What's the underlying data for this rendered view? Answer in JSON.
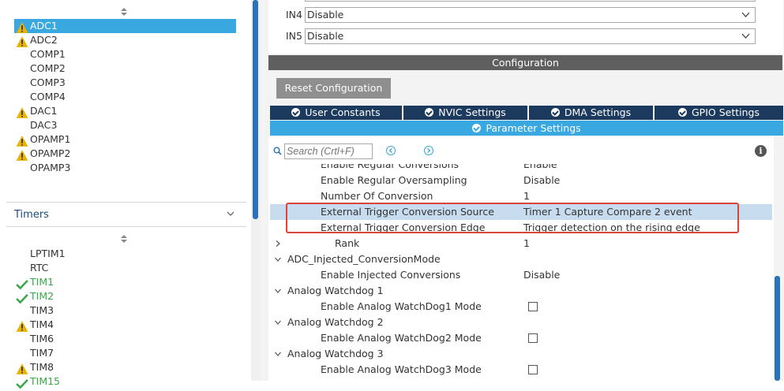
{
  "left_panel": {
    "analog_items": [
      {
        "label": "ADC1",
        "status": "warning",
        "selected": true
      },
      {
        "label": "ADC2",
        "status": "warning",
        "selected": false
      },
      {
        "label": "COMP1",
        "status": "none",
        "selected": false
      },
      {
        "label": "COMP2",
        "status": "none",
        "selected": false
      },
      {
        "label": "COMP3",
        "status": "none",
        "selected": false
      },
      {
        "label": "COMP4",
        "status": "none",
        "selected": false
      },
      {
        "label": "DAC1",
        "status": "warning",
        "selected": false
      },
      {
        "label": "DAC3",
        "status": "none",
        "selected": false
      },
      {
        "label": "OPAMP1",
        "status": "warning",
        "selected": false
      },
      {
        "label": "OPAMP2",
        "status": "warning",
        "selected": false
      },
      {
        "label": "OPAMP3",
        "status": "none",
        "selected": false
      }
    ],
    "timers_title": "Timers",
    "timer_items": [
      {
        "label": "LPTIM1",
        "status": "none"
      },
      {
        "label": "RTC",
        "status": "none"
      },
      {
        "label": "TIM1",
        "status": "ok"
      },
      {
        "label": "TIM2",
        "status": "ok"
      },
      {
        "label": "TIM3",
        "status": "none"
      },
      {
        "label": "TIM4",
        "status": "warning"
      },
      {
        "label": "TIM6",
        "status": "none"
      },
      {
        "label": "TIM7",
        "status": "none"
      },
      {
        "label": "TIM8",
        "status": "warning"
      },
      {
        "label": "TIM15",
        "status": "ok"
      }
    ]
  },
  "inputs": {
    "in4": {
      "label": "IN4",
      "value": "Disable"
    },
    "in5": {
      "label": "IN5",
      "value": "Disable"
    }
  },
  "configuration": {
    "header": "Configuration",
    "reset_button": "Reset Configuration",
    "tabs": [
      "User Constants",
      "NVIC Settings",
      "DMA Settings",
      "GPIO Settings"
    ],
    "active_tab": "Parameter Settings",
    "search_placeholder": "Search (Crtl+F)"
  },
  "parameters": [
    {
      "label": "Enable Regular Conversions",
      "value": "Enable",
      "indent": 2,
      "kind": "value"
    },
    {
      "label": "Enable Regular Oversampling",
      "value": "Disable",
      "indent": 2,
      "kind": "value"
    },
    {
      "label": "Number Of Conversion",
      "value": "1",
      "indent": 2,
      "kind": "value"
    },
    {
      "label": "External Trigger Conversion Source",
      "value": "Timer 1 Capture Compare 2 event",
      "indent": 2,
      "kind": "value",
      "highlight": true
    },
    {
      "label": "External Trigger Conversion Edge",
      "value": "Trigger detection on the rising edge",
      "indent": 2,
      "kind": "value"
    },
    {
      "label": "Rank",
      "value": "1",
      "indent": 3,
      "kind": "collapsed"
    },
    {
      "label": "ADC_Injected_ConversionMode",
      "value": "",
      "indent": 1,
      "kind": "group"
    },
    {
      "label": "Enable Injected Conversions",
      "value": "Disable",
      "indent": 2,
      "kind": "value"
    },
    {
      "label": "Analog Watchdog 1",
      "value": "",
      "indent": 1,
      "kind": "group"
    },
    {
      "label": "Enable Analog WatchDog1 Mode",
      "value": "",
      "indent": 2,
      "kind": "checkbox"
    },
    {
      "label": "Analog Watchdog 2",
      "value": "",
      "indent": 1,
      "kind": "group"
    },
    {
      "label": "Enable Analog WatchDog2 Mode",
      "value": "",
      "indent": 2,
      "kind": "checkbox"
    },
    {
      "label": "Analog Watchdog 3",
      "value": "",
      "indent": 1,
      "kind": "group"
    },
    {
      "label": "Enable Analog WatchDog3 Mode",
      "value": "",
      "indent": 2,
      "kind": "checkbox"
    }
  ],
  "colors": {
    "selected": "#39a7e0",
    "ok": "#39a74a",
    "warning": "#e8b400",
    "tab_bg": "#1b3a5e",
    "highlight_box": "#d9453a"
  }
}
